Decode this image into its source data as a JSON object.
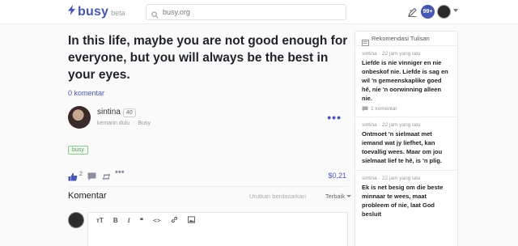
{
  "header": {
    "logo_text": "busy",
    "logo_suffix": "beta",
    "search_value": "busy.org",
    "notification_count": "99+"
  },
  "post": {
    "title": "In this life, maybe you are not good enough for everyone, but you will always be the best in your eyes.",
    "comments_link": "0 komentar",
    "author": {
      "name": "sintina",
      "reputation": "40",
      "time": "kemarin dulu",
      "app": "Busy"
    },
    "tag": "busy",
    "votes_count": "2",
    "payout": "$0,21"
  },
  "comments_section": {
    "title": "Komentar",
    "sort_label": "Urutkan berdasarkan",
    "sort_value": "Terbaik"
  },
  "editor_toolbar": {
    "heading": "ᴛT",
    "bold": "B",
    "italic": "I",
    "quote": "❝",
    "code": "<>",
    "link": "🔗",
    "image": "▣"
  },
  "sidebar": {
    "title": "Rekomendasi Tulisan",
    "items": [
      {
        "author": "sintina",
        "time": "22 jam yang lalu",
        "title": "Liefde is nie vinniger en nie onbeskof nie. Liefde is sag en wil 'n gemeenskaplike goed hê, nie 'n oorwinning alleen nie.",
        "comments": "1 komentar"
      },
      {
        "author": "sintina",
        "time": "22 jam yang lalu",
        "title": "Ontmoet 'n sielmaat met iemand wat jy liefhet, kan toevallig wees. Maar om jou sielmaat lief te hê, is 'n plig."
      },
      {
        "author": "sintina",
        "time": "22 jam yang lalu",
        "title": "Ek is net besig om die beste minnaar te wees, maat probleem of nie, laat God besluit"
      }
    ]
  },
  "colors": {
    "accent": "#4757b2",
    "tag_green": "#5a9e5a"
  },
  "icons": [
    "bolt-icon",
    "search-icon",
    "write-icon",
    "like-icon",
    "comment-icon",
    "reblog-icon",
    "more-icon",
    "document-icon",
    "chevron-down-icon"
  ]
}
